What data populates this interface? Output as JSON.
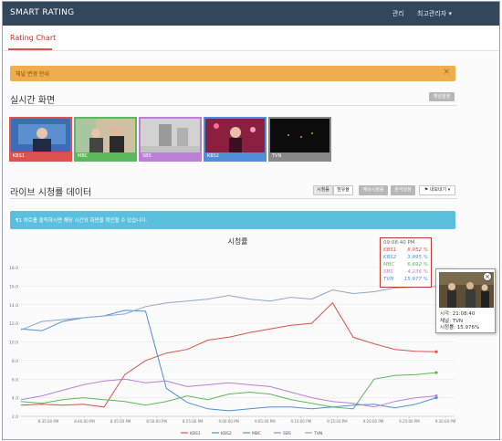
{
  "app": {
    "title": "SMART RATING"
  },
  "topbar": {
    "admin_link": "관리",
    "user_menu": "최고관리자 ▾"
  },
  "subnav": {
    "active_tab": "Rating Chart"
  },
  "alerts": {
    "orange": {
      "text": "채널 변경 안내",
      "close": "×"
    },
    "blue": {
      "text": "¶1 차트를 클릭하시면 해당 시간의 화면을 확인할 수 있습니다."
    }
  },
  "realtime": {
    "title": "실시간 화면",
    "settings_button": "채널설정",
    "channels": [
      {
        "label": "KBS1",
        "color": "#d9534f"
      },
      {
        "label": "MBC",
        "color": "#5cb85c"
      },
      {
        "label": "SBS",
        "color": "#b980d6"
      },
      {
        "label": "KBS2",
        "color": "#4f8fd6"
      },
      {
        "label": "TVN",
        "color": "#888888"
      }
    ]
  },
  "live": {
    "title": "라이브 시청률 데이터",
    "buttons": {
      "rating": "시청률",
      "share": "점유율",
      "audience": "예상시청률",
      "time_setting": "분석설정",
      "export": "⚑ 내보내기 ▾"
    }
  },
  "chart_data": {
    "type": "line",
    "title": "시청률",
    "x": [
      "8:35:00 PM",
      "8:40:00 PM",
      "8:45:00 PM",
      "8:50:00 PM",
      "8:55:00 PM",
      "9:00:00 PM",
      "9:05:00 PM",
      "9:10:00 PM",
      "9:15:00 PM",
      "9:20:00 PM",
      "9:25:00 PM",
      "9:30:00 PM"
    ],
    "ylim": [
      2,
      18
    ],
    "yticks": [
      "2.0",
      "4.0",
      "6.0",
      "8.0",
      "10.0",
      "12.0",
      "14.0",
      "16.0",
      "18.0"
    ],
    "series": [
      {
        "name": "KBS1",
        "color": "#d9534f",
        "values": [
          3.2,
          3.3,
          3.2,
          3.3,
          3.0,
          6.5,
          8.0,
          8.8,
          9.2,
          10.2,
          10.5,
          11.0,
          11.4,
          11.8,
          12.0,
          14.2,
          10.5,
          9.8,
          9.2,
          9.0,
          8.95
        ]
      },
      {
        "name": "KBS2",
        "color": "#4f8fd6",
        "values": [
          11.4,
          11.2,
          12.2,
          12.6,
          12.8,
          13.4,
          13.3,
          5.0,
          3.5,
          2.8,
          2.6,
          2.8,
          3.0,
          3.0,
          2.8,
          3.0,
          3.2,
          3.3,
          2.9,
          3.3,
          4.0
        ]
      },
      {
        "name": "MBC",
        "color": "#5cb85c",
        "values": [
          3.6,
          3.4,
          3.8,
          4.0,
          3.8,
          3.6,
          3.2,
          3.6,
          4.2,
          3.8,
          4.4,
          4.6,
          4.4,
          3.8,
          3.4,
          3.0,
          2.8,
          6.0,
          6.4,
          6.5,
          6.7
        ]
      },
      {
        "name": "SBS",
        "color": "#b980d6",
        "values": [
          3.8,
          4.2,
          4.8,
          5.4,
          5.8,
          6.0,
          5.6,
          5.8,
          5.2,
          5.4,
          5.6,
          5.4,
          5.2,
          4.6,
          4.0,
          3.6,
          3.4,
          3.0,
          3.6,
          4.0,
          4.2
        ]
      },
      {
        "name": "TVN",
        "color": "#8fa8c8",
        "values": [
          11.3,
          12.2,
          12.4,
          12.6,
          12.8,
          13.0,
          13.8,
          14.2,
          14.4,
          14.6,
          15.0,
          14.6,
          14.4,
          14.8,
          14.6,
          15.6,
          15.2,
          15.4,
          15.8,
          15.9,
          15.98
        ]
      }
    ]
  },
  "tooltip": {
    "time": "09:08:40 PM",
    "rows": [
      {
        "name": "KBS1",
        "value": "8.952",
        "unit": "%",
        "color": "#d9534f"
      },
      {
        "name": "KBS2",
        "value": "3.995",
        "unit": "%",
        "color": "#4f8fd6"
      },
      {
        "name": "MBC",
        "value": "6.692",
        "unit": "%",
        "color": "#5cb85c"
      },
      {
        "name": "SBS",
        "value": "4.236",
        "unit": "%",
        "color": "#b980d6"
      },
      {
        "name": "TVN",
        "value": "15.977",
        "unit": "%",
        "color": "#4f8fd6"
      }
    ]
  },
  "popup": {
    "time": "시각: 21:08:40",
    "channel": "채널: TVN",
    "rating": "시청률: 15.976%",
    "close": "×"
  }
}
